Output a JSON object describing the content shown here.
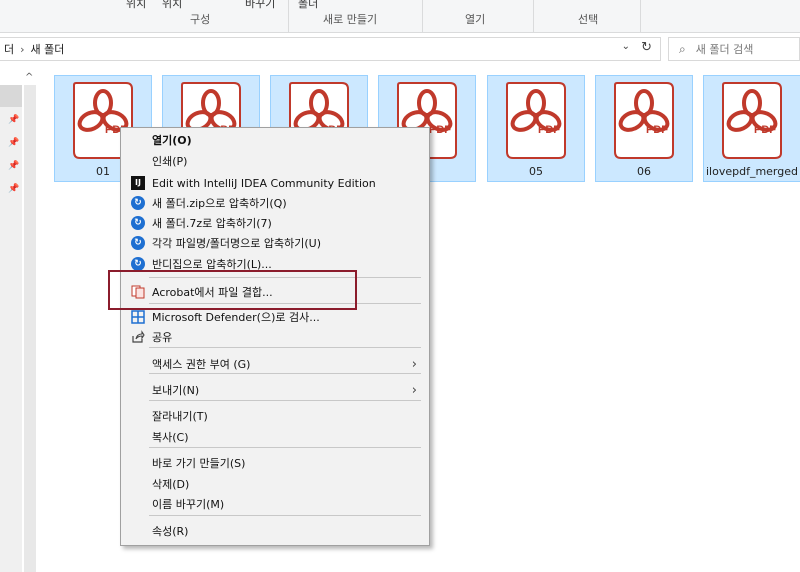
{
  "ribbon": {
    "cut_labels": [
      "위치",
      "위치",
      "바꾸기",
      "폴더"
    ],
    "groups": [
      "구성",
      "새로 만들기",
      "열기",
      "선택"
    ]
  },
  "address": {
    "path_parent": "더",
    "path_current": "새 폴더",
    "search_placeholder": "새 폴더 검색"
  },
  "files": [
    {
      "name": "01"
    },
    {
      "name": ""
    },
    {
      "name": ""
    },
    {
      "name": "4"
    },
    {
      "name": "05"
    },
    {
      "name": "06"
    },
    {
      "name": "ilovepdf_merged"
    }
  ],
  "icon_text": "PDF",
  "context_menu": {
    "items": [
      {
        "label": "열기(O)",
        "bold": true
      },
      {
        "label": "인쇄(P)"
      },
      {
        "label": "Edit with IntelliJ IDEA Community Edition",
        "icon": "intellij-icon",
        "icon_text": "IJ"
      },
      {
        "label": "새 폴더.zip으로 압축하기(Q)",
        "icon": "bandizip-icon"
      },
      {
        "label": "새 폴더.7z로 압축하기(7)",
        "icon": "bandizip-icon"
      },
      {
        "label": "각각 파일명/폴더명으로 압축하기(U)",
        "icon": "bandizip-icon"
      },
      {
        "label": "반디집으로 압축하기(L)...",
        "icon": "bandizip-icon"
      },
      {
        "label": "Acrobat에서 파일 결합...",
        "icon": "acrobat-combine-icon"
      },
      {
        "label": "Microsoft Defender(으)로 검사...",
        "icon": "defender-icon"
      },
      {
        "label": "공유",
        "icon": "share-icon"
      },
      {
        "label": "액세스 권한 부여 (G)",
        "submenu": true
      },
      {
        "label": "보내기(N)",
        "submenu": true
      },
      {
        "label": "잘라내기(T)"
      },
      {
        "label": "복사(C)"
      },
      {
        "label": "바로 가기 만들기(S)"
      },
      {
        "label": "삭제(D)"
      },
      {
        "label": "이름 바꾸기(M)"
      },
      {
        "label": "속성(R)"
      }
    ]
  },
  "colors": {
    "selection_fill": "#cce8ff",
    "selection_border": "#99d1ff",
    "pdf_red": "#c0392b",
    "highlight_border": "#8b1c2c"
  }
}
